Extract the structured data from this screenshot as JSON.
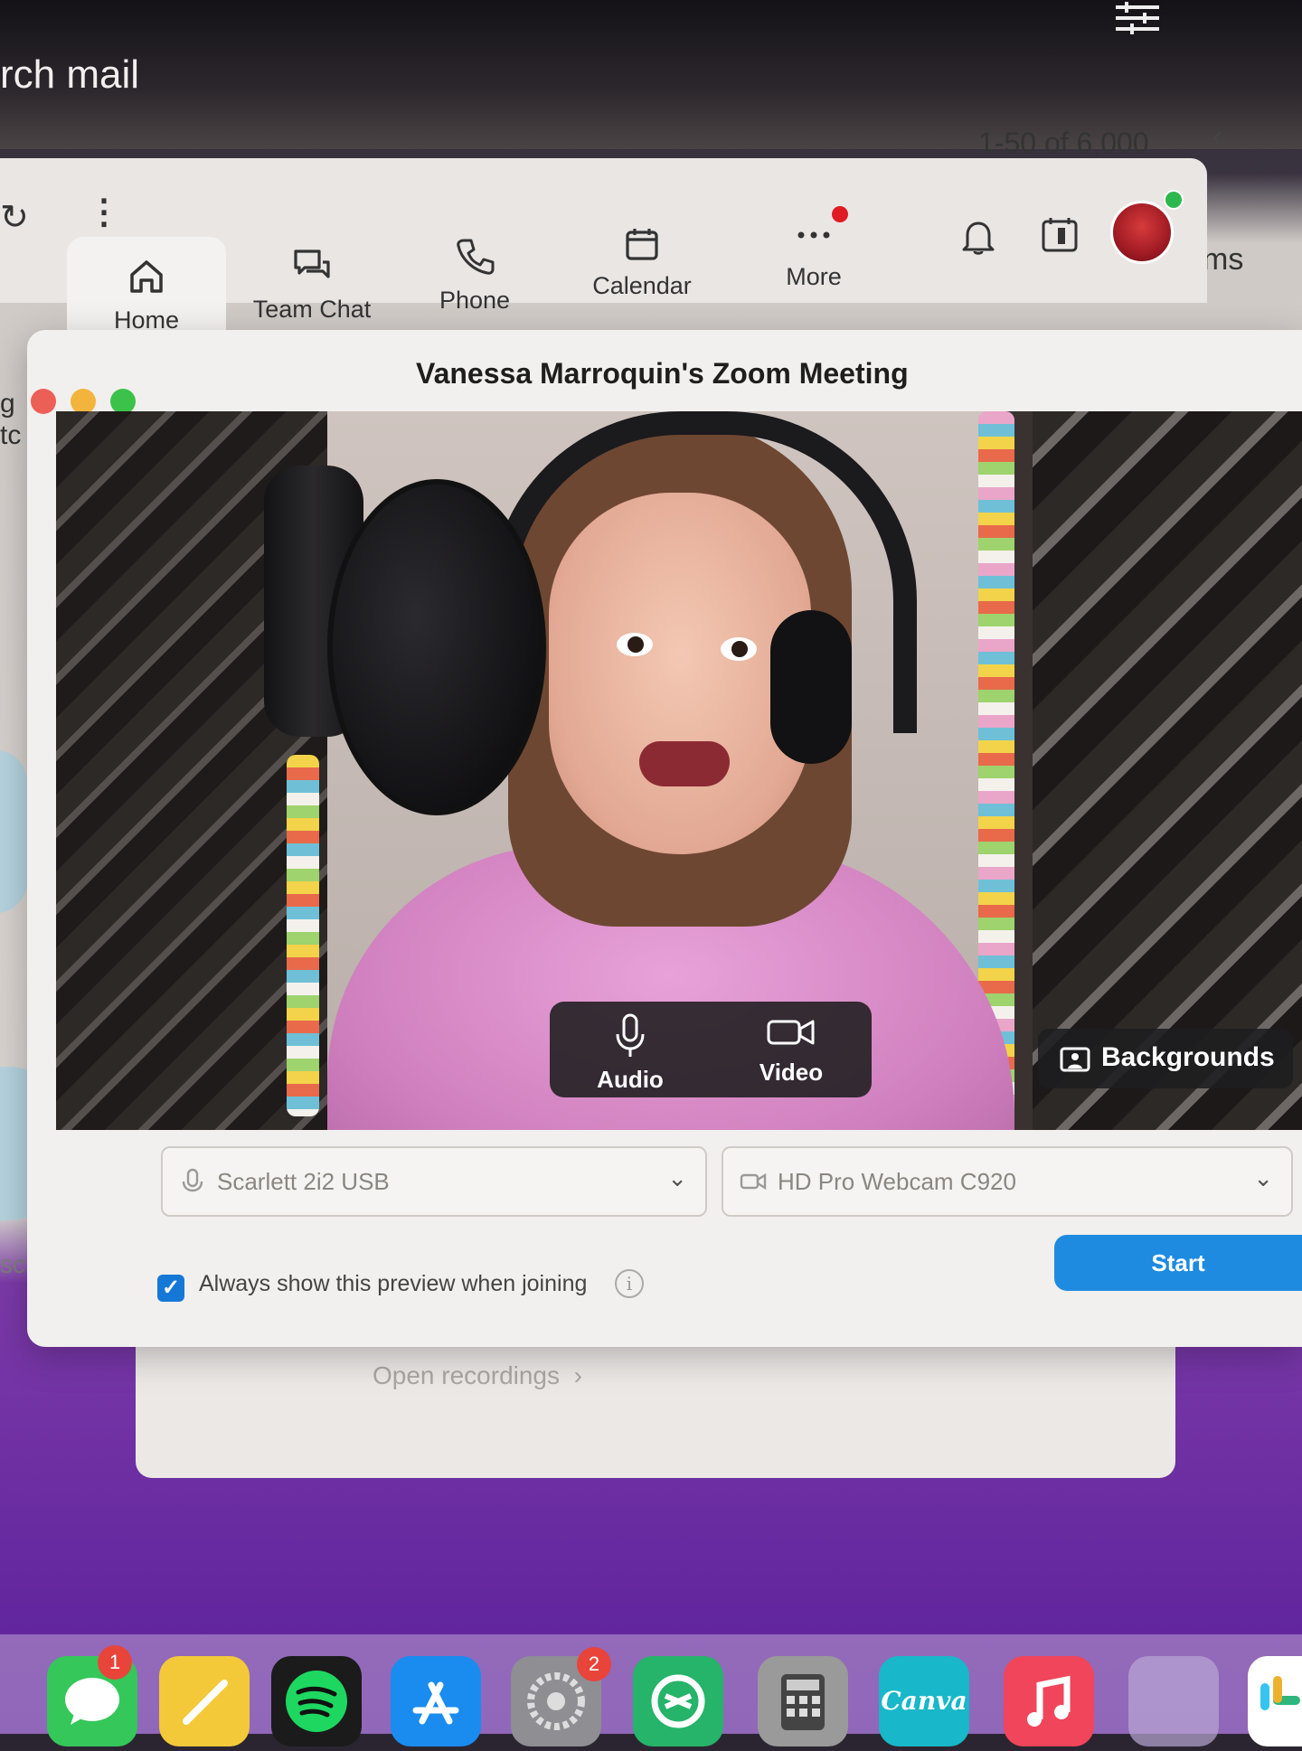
{
  "mail": {
    "search_label": "rch mail",
    "count": "1-50 of 6,000",
    "side_text": "ms",
    "left_text_a": "g",
    "left_text_b": "tc",
    "screen_label": "screen"
  },
  "zoom_nav": {
    "items": [
      {
        "label": "Home",
        "icon": "home-icon"
      },
      {
        "label": "Team Chat",
        "icon": "chat-icon"
      },
      {
        "label": "Phone",
        "icon": "phone-icon"
      },
      {
        "label": "Calendar",
        "icon": "calendar-icon"
      },
      {
        "label": "More",
        "icon": "more-icon"
      }
    ]
  },
  "preview": {
    "title": "Vanessa Marroquin's Zoom Meeting",
    "audio_label": "Audio",
    "video_label": "Video",
    "backgrounds_label": "Backgrounds",
    "mic_select": "Scarlett 2i2 USB",
    "camera_select": "HD Pro Webcam C920",
    "checkbox_label": "Always show this preview when joining",
    "checkbox_checked": true,
    "start_label": "Start"
  },
  "below": {
    "open_recordings": "Open recordings"
  },
  "dock": {
    "messages_badge": "1",
    "settings_badge": "2",
    "canva_label": "Canva"
  },
  "colors": {
    "accent": "#1e8be0",
    "notification": "#e01b24",
    "presence": "#2db84d"
  }
}
